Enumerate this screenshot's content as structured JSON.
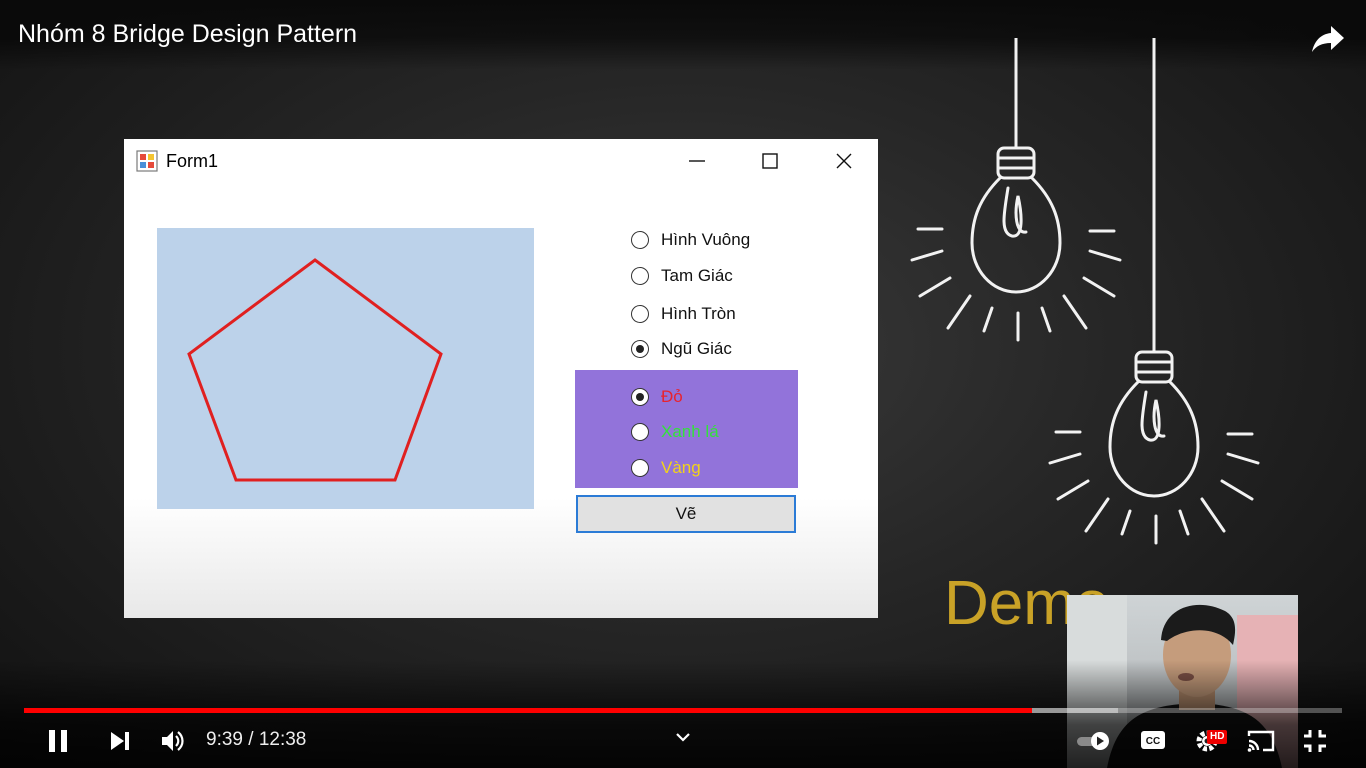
{
  "video": {
    "title": "Nhóm 8 Bridge Design Pattern"
  },
  "form": {
    "title": "Form1",
    "shape_options": [
      {
        "label": "Hình Vuông",
        "checked": false
      },
      {
        "label": "Tam Giác",
        "checked": false
      },
      {
        "label": "Hình Tròn",
        "checked": false
      },
      {
        "label": "Ngũ Giác",
        "checked": true
      }
    ],
    "color_options": [
      {
        "label": "Đỏ",
        "checked": true,
        "color": "#e8232e"
      },
      {
        "label": "Xanh lá",
        "checked": false,
        "color": "#33e23a"
      },
      {
        "label": "Vàng",
        "checked": false,
        "color": "#f2d21a"
      }
    ],
    "draw_label": "Vẽ",
    "canvas_color": "#bcd2ea",
    "drawn_shape": {
      "type": "pentagon",
      "stroke": "#e02020"
    },
    "color_group_bg": "#9273da"
  },
  "slide": {
    "demo_text": "Demo",
    "accent": "#c9a227"
  },
  "player": {
    "time_display": "9:39 / 12:38",
    "progress_fraction": 0.765,
    "buffered_fraction": 0.83,
    "hd_badge": "HD",
    "icons": [
      "pause-icon",
      "next-icon",
      "volume-icon",
      "chevron-down-icon",
      "autoplay-toggle-icon",
      "captions-icon",
      "settings-icon",
      "cast-icon",
      "exit-fullscreen-icon",
      "share-icon"
    ]
  }
}
